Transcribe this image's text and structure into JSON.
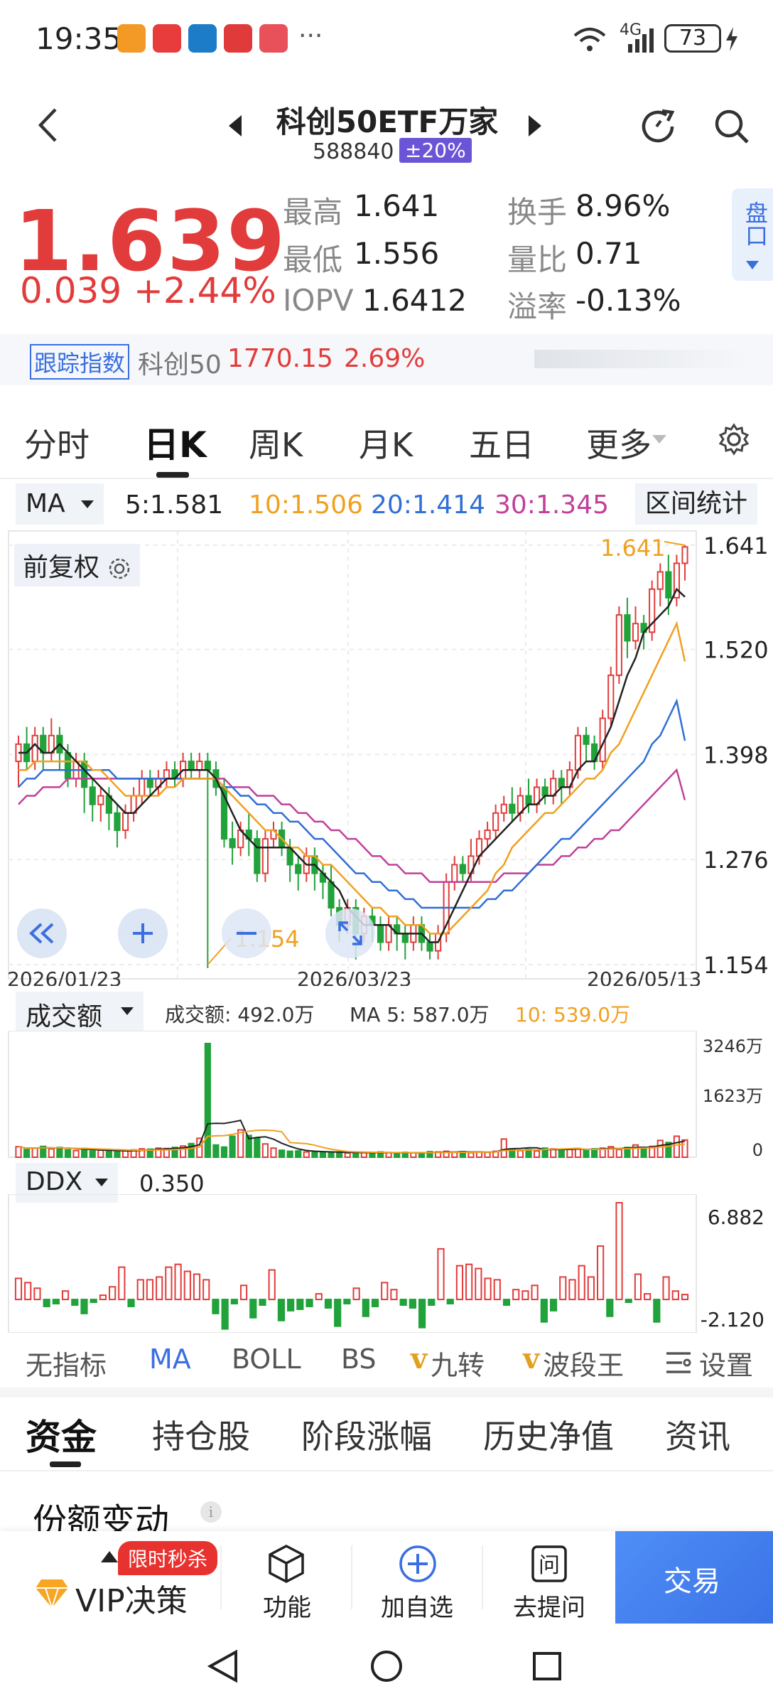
{
  "status": {
    "time": "19:35",
    "dots": "···",
    "signal": "4G",
    "battery": "73"
  },
  "header": {
    "title": "科创50ETF万家",
    "code": "588840",
    "limit_badge": "±20%"
  },
  "quote": {
    "price": "1.639",
    "change": "0.039",
    "change_pct": "+2.44%",
    "stats": [
      {
        "label": "最高",
        "value": "1.641"
      },
      {
        "label": "最低",
        "value": "1.556"
      },
      {
        "label": "IOPV",
        "value": "1.6412"
      },
      {
        "label": "换手",
        "value": "8.96%"
      },
      {
        "label": "量比",
        "value": "0.71"
      },
      {
        "label": "溢率",
        "value": "-0.13%"
      }
    ],
    "side_tab": "盘口"
  },
  "tracking": {
    "badge": "跟踪指数",
    "index_name": "科创50",
    "index_value": "1770.15",
    "index_pct": "2.69%"
  },
  "tabs": [
    "分时",
    "日K",
    "周K",
    "月K",
    "五日",
    "更多"
  ],
  "ma_bar": {
    "selector": "MA",
    "ma5": "5:1.581",
    "ma10": "10:1.506",
    "ma20": "20:1.414",
    "ma30": "30:1.345",
    "range_btn": "区间统计"
  },
  "colors": {
    "up": "#e23b3b",
    "down": "#21a23a",
    "ma5": "#222222",
    "ma10": "#f0a020",
    "ma20": "#2f6fd6",
    "ma30": "#c0409a",
    "accent": "#3b6fe0"
  },
  "main_chart": {
    "fq_label": "前复权",
    "y_ticks": [
      "1.641",
      "1.520",
      "1.398",
      "1.276",
      "1.154"
    ],
    "x_ticks": [
      "2026/01/23",
      "2026/03/23",
      "2026/05/13"
    ],
    "high_mark": "1.641",
    "low_mark": "1.154"
  },
  "volume": {
    "selector": "成交额",
    "label": "成交额: 492.0万",
    "ma5": "MA 5: 587.0万",
    "ma10": "10: 539.0万",
    "y_ticks": [
      "3246万",
      "1623万",
      "0"
    ]
  },
  "ddx": {
    "selector": "DDX",
    "value": "0.350",
    "y_ticks": [
      "6.882",
      "-2.120"
    ]
  },
  "indicators": [
    "无指标",
    "MA",
    "BOLL",
    "BS",
    "九转",
    "波段王",
    "设置"
  ],
  "content_tabs": [
    "资金",
    "持仓股",
    "阶段涨幅",
    "历史净值",
    "资讯"
  ],
  "section_title": "份额变动",
  "bottom": {
    "vip_badge": "限时秒杀",
    "vip": "VIP决策",
    "func": "功能",
    "add": "加自选",
    "ask": "去提问",
    "trade": "交易"
  },
  "chart_data": [
    {
      "type": "candlestick",
      "ylim": [
        1.154,
        1.641
      ],
      "y_ticks": [
        "1.641",
        "1.520",
        "1.398",
        "1.276",
        "1.154"
      ],
      "x_ticks": [
        "2026/01/23",
        "2026/03/23",
        "2026/05/13"
      ],
      "candles": [
        [
          1.39,
          1.41,
          1.36,
          1.42
        ],
        [
          1.41,
          1.39,
          1.38,
          1.43
        ],
        [
          1.39,
          1.42,
          1.38,
          1.43
        ],
        [
          1.42,
          1.4,
          1.38,
          1.43
        ],
        [
          1.4,
          1.42,
          1.39,
          1.44
        ],
        [
          1.42,
          1.4,
          1.38,
          1.43
        ],
        [
          1.4,
          1.37,
          1.36,
          1.41
        ],
        [
          1.37,
          1.39,
          1.36,
          1.4
        ],
        [
          1.39,
          1.36,
          1.33,
          1.4
        ],
        [
          1.36,
          1.34,
          1.32,
          1.37
        ],
        [
          1.34,
          1.35,
          1.32,
          1.36
        ],
        [
          1.35,
          1.33,
          1.31,
          1.36
        ],
        [
          1.33,
          1.31,
          1.29,
          1.34
        ],
        [
          1.31,
          1.33,
          1.3,
          1.34
        ],
        [
          1.33,
          1.35,
          1.32,
          1.36
        ],
        [
          1.35,
          1.37,
          1.34,
          1.38
        ],
        [
          1.37,
          1.36,
          1.35,
          1.38
        ],
        [
          1.36,
          1.37,
          1.35,
          1.38
        ],
        [
          1.37,
          1.38,
          1.36,
          1.39
        ],
        [
          1.38,
          1.37,
          1.36,
          1.39
        ],
        [
          1.37,
          1.39,
          1.36,
          1.4
        ],
        [
          1.39,
          1.38,
          1.37,
          1.4
        ],
        [
          1.38,
          1.39,
          1.37,
          1.4
        ],
        [
          1.39,
          1.38,
          1.15,
          1.4
        ],
        [
          1.38,
          1.36,
          1.35,
          1.39
        ],
        [
          1.36,
          1.3,
          1.29,
          1.37
        ],
        [
          1.3,
          1.29,
          1.27,
          1.32
        ],
        [
          1.29,
          1.31,
          1.28,
          1.32
        ],
        [
          1.31,
          1.3,
          1.28,
          1.33
        ],
        [
          1.3,
          1.26,
          1.25,
          1.31
        ],
        [
          1.26,
          1.3,
          1.25,
          1.31
        ],
        [
          1.3,
          1.31,
          1.29,
          1.32
        ],
        [
          1.31,
          1.29,
          1.28,
          1.32
        ],
        [
          1.29,
          1.27,
          1.25,
          1.3
        ],
        [
          1.27,
          1.26,
          1.24,
          1.28
        ],
        [
          1.26,
          1.28,
          1.25,
          1.29
        ],
        [
          1.28,
          1.26,
          1.24,
          1.29
        ],
        [
          1.26,
          1.25,
          1.23,
          1.27
        ],
        [
          1.25,
          1.22,
          1.21,
          1.27
        ],
        [
          1.22,
          1.2,
          1.18,
          1.23
        ],
        [
          1.2,
          1.22,
          1.19,
          1.23
        ],
        [
          1.22,
          1.19,
          1.16,
          1.23
        ],
        [
          1.19,
          1.21,
          1.18,
          1.22
        ],
        [
          1.21,
          1.2,
          1.18,
          1.22
        ],
        [
          1.2,
          1.18,
          1.17,
          1.21
        ],
        [
          1.18,
          1.2,
          1.17,
          1.21
        ],
        [
          1.2,
          1.19,
          1.17,
          1.21
        ],
        [
          1.19,
          1.18,
          1.16,
          1.2
        ],
        [
          1.18,
          1.2,
          1.17,
          1.21
        ],
        [
          1.2,
          1.18,
          1.17,
          1.21
        ],
        [
          1.18,
          1.17,
          1.16,
          1.19
        ],
        [
          1.17,
          1.19,
          1.16,
          1.2
        ],
        [
          1.19,
          1.25,
          1.18,
          1.26
        ],
        [
          1.25,
          1.27,
          1.24,
          1.28
        ],
        [
          1.27,
          1.26,
          1.25,
          1.28
        ],
        [
          1.26,
          1.28,
          1.25,
          1.3
        ],
        [
          1.28,
          1.3,
          1.27,
          1.31
        ],
        [
          1.3,
          1.31,
          1.29,
          1.32
        ],
        [
          1.31,
          1.33,
          1.3,
          1.34
        ],
        [
          1.33,
          1.34,
          1.32,
          1.35
        ],
        [
          1.34,
          1.33,
          1.32,
          1.36
        ],
        [
          1.33,
          1.35,
          1.32,
          1.36
        ],
        [
          1.35,
          1.34,
          1.33,
          1.37
        ],
        [
          1.34,
          1.36,
          1.33,
          1.37
        ],
        [
          1.36,
          1.35,
          1.34,
          1.37
        ],
        [
          1.35,
          1.37,
          1.34,
          1.38
        ],
        [
          1.37,
          1.36,
          1.34,
          1.38
        ],
        [
          1.36,
          1.38,
          1.35,
          1.39
        ],
        [
          1.38,
          1.42,
          1.37,
          1.43
        ],
        [
          1.42,
          1.41,
          1.39,
          1.43
        ],
        [
          1.41,
          1.39,
          1.38,
          1.42
        ],
        [
          1.39,
          1.44,
          1.38,
          1.45
        ],
        [
          1.44,
          1.49,
          1.43,
          1.5
        ],
        [
          1.49,
          1.56,
          1.48,
          1.57
        ],
        [
          1.56,
          1.53,
          1.51,
          1.58
        ],
        [
          1.53,
          1.55,
          1.52,
          1.57
        ],
        [
          1.55,
          1.54,
          1.52,
          1.56
        ],
        [
          1.54,
          1.59,
          1.53,
          1.6
        ],
        [
          1.59,
          1.61,
          1.57,
          1.62
        ],
        [
          1.61,
          1.58,
          1.56,
          1.63
        ],
        [
          1.58,
          1.62,
          1.57,
          1.63
        ],
        [
          1.62,
          1.639,
          1.6,
          1.641
        ]
      ],
      "ma": {
        "ma5": [
          1.4,
          1.4,
          1.41,
          1.4,
          1.4,
          1.41,
          1.4,
          1.39,
          1.38,
          1.37,
          1.36,
          1.35,
          1.34,
          1.33,
          1.33,
          1.34,
          1.35,
          1.36,
          1.37,
          1.37,
          1.38,
          1.38,
          1.38,
          1.38,
          1.37,
          1.35,
          1.33,
          1.31,
          1.3,
          1.29,
          1.29,
          1.29,
          1.29,
          1.29,
          1.28,
          1.27,
          1.27,
          1.26,
          1.25,
          1.24,
          1.22,
          1.21,
          1.2,
          1.2,
          1.2,
          1.2,
          1.19,
          1.19,
          1.19,
          1.19,
          1.18,
          1.18,
          1.2,
          1.22,
          1.24,
          1.26,
          1.28,
          1.29,
          1.3,
          1.31,
          1.32,
          1.33,
          1.34,
          1.34,
          1.35,
          1.35,
          1.36,
          1.36,
          1.38,
          1.39,
          1.39,
          1.41,
          1.43,
          1.46,
          1.49,
          1.51,
          1.54,
          1.55,
          1.56,
          1.57,
          1.59,
          1.581
        ],
        "ma10": [
          1.38,
          1.38,
          1.39,
          1.39,
          1.39,
          1.39,
          1.39,
          1.39,
          1.39,
          1.38,
          1.38,
          1.37,
          1.36,
          1.35,
          1.35,
          1.35,
          1.35,
          1.35,
          1.36,
          1.36,
          1.37,
          1.37,
          1.37,
          1.37,
          1.37,
          1.36,
          1.35,
          1.34,
          1.33,
          1.32,
          1.31,
          1.31,
          1.3,
          1.29,
          1.29,
          1.28,
          1.28,
          1.27,
          1.27,
          1.26,
          1.25,
          1.24,
          1.23,
          1.22,
          1.22,
          1.21,
          1.21,
          1.2,
          1.2,
          1.2,
          1.19,
          1.19,
          1.19,
          1.2,
          1.21,
          1.22,
          1.23,
          1.24,
          1.26,
          1.27,
          1.29,
          1.3,
          1.31,
          1.32,
          1.33,
          1.33,
          1.34,
          1.35,
          1.36,
          1.37,
          1.37,
          1.38,
          1.4,
          1.41,
          1.43,
          1.45,
          1.47,
          1.49,
          1.51,
          1.53,
          1.55,
          1.506
        ],
        "ma20": [
          1.36,
          1.37,
          1.37,
          1.38,
          1.38,
          1.38,
          1.38,
          1.38,
          1.38,
          1.38,
          1.38,
          1.38,
          1.37,
          1.37,
          1.37,
          1.37,
          1.37,
          1.37,
          1.37,
          1.37,
          1.37,
          1.37,
          1.37,
          1.37,
          1.37,
          1.36,
          1.36,
          1.35,
          1.35,
          1.34,
          1.34,
          1.33,
          1.33,
          1.32,
          1.32,
          1.31,
          1.3,
          1.3,
          1.29,
          1.28,
          1.27,
          1.26,
          1.26,
          1.25,
          1.25,
          1.24,
          1.24,
          1.23,
          1.23,
          1.22,
          1.22,
          1.22,
          1.22,
          1.22,
          1.22,
          1.22,
          1.22,
          1.23,
          1.23,
          1.24,
          1.24,
          1.25,
          1.26,
          1.27,
          1.28,
          1.29,
          1.3,
          1.3,
          1.31,
          1.32,
          1.33,
          1.34,
          1.35,
          1.36,
          1.37,
          1.38,
          1.39,
          1.41,
          1.42,
          1.44,
          1.46,
          1.414
        ],
        "ma30": [
          1.34,
          1.35,
          1.35,
          1.36,
          1.36,
          1.36,
          1.37,
          1.37,
          1.37,
          1.37,
          1.37,
          1.37,
          1.37,
          1.37,
          1.37,
          1.37,
          1.37,
          1.37,
          1.37,
          1.37,
          1.37,
          1.37,
          1.37,
          1.37,
          1.37,
          1.37,
          1.36,
          1.36,
          1.36,
          1.35,
          1.35,
          1.35,
          1.34,
          1.34,
          1.33,
          1.33,
          1.32,
          1.32,
          1.31,
          1.31,
          1.3,
          1.3,
          1.29,
          1.28,
          1.28,
          1.27,
          1.27,
          1.26,
          1.26,
          1.26,
          1.25,
          1.25,
          1.25,
          1.25,
          1.25,
          1.25,
          1.25,
          1.25,
          1.25,
          1.26,
          1.26,
          1.26,
          1.26,
          1.27,
          1.27,
          1.27,
          1.28,
          1.28,
          1.29,
          1.29,
          1.3,
          1.3,
          1.31,
          1.31,
          1.32,
          1.33,
          1.34,
          1.35,
          1.36,
          1.37,
          1.38,
          1.345
        ]
      }
    },
    {
      "type": "bar",
      "title": "成交额",
      "ylim": [
        0,
        3246
      ],
      "values": [
        300,
        220,
        260,
        310,
        240,
        280,
        210,
        190,
        250,
        180,
        200,
        170,
        160,
        190,
        210,
        240,
        230,
        260,
        250,
        280,
        320,
        390,
        540,
        3246,
        350,
        290,
        600,
        780,
        620,
        540,
        380,
        260,
        200,
        170,
        180,
        150,
        160,
        140,
        130,
        150,
        120,
        140,
        130,
        120,
        150,
        130,
        110,
        140,
        130,
        120,
        160,
        150,
        170,
        140,
        160,
        130,
        150,
        140,
        170,
        520,
        240,
        190,
        220,
        180,
        260,
        240,
        200,
        230,
        250,
        210,
        240,
        260,
        300,
        220,
        280,
        350,
        270,
        310,
        480,
        420,
        600,
        492
      ]
    },
    {
      "type": "bar",
      "title": "DDX",
      "ylim": [
        -2.12,
        6.882
      ],
      "values": [
        1.5,
        1.2,
        0.8,
        -0.5,
        -0.3,
        0.6,
        -0.4,
        -1.0,
        -0.2,
        0.3,
        0.9,
        2.3,
        -0.5,
        1.4,
        1.4,
        1.6,
        2.3,
        2.5,
        2.0,
        1.8,
        1.4,
        -1.0,
        -2.1,
        -0.3,
        1.0,
        -1.3,
        -0.4,
        2.1,
        -1.5,
        -0.8,
        -0.7,
        -0.5,
        0.4,
        -0.6,
        -1.9,
        -0.3,
        0.8,
        -1.2,
        -0.5,
        1.2,
        0.7,
        -0.4,
        -0.6,
        -2.0,
        -0.4,
        3.6,
        -0.3,
        2.4,
        2.5,
        2.2,
        1.5,
        1.4,
        -0.4,
        0.7,
        0.6,
        1.0,
        -1.6,
        -0.8,
        1.6,
        1.4,
        2.4,
        1.6,
        3.8,
        -1.2,
        6.882,
        -0.2,
        1.8,
        0.4,
        -1.6,
        1.6,
        0.6,
        0.35
      ]
    }
  ]
}
